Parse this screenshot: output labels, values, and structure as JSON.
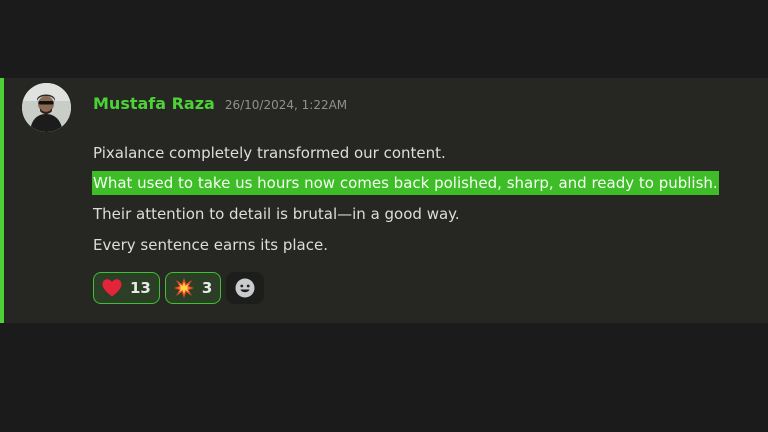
{
  "message": {
    "username": "Mustafa Raza",
    "timestamp": "26/10/2024, 1:22AM",
    "lines": [
      "Pixalance completely transformed our content.",
      "What used to take us hours now comes back polished, sharp, and ready to publish.",
      "Their attention to detail is brutal—in a good way.",
      "Every sentence earns its place."
    ],
    "highlighted_line_index": 1
  },
  "reactions": [
    {
      "emoji": "heart-icon",
      "count": "13"
    },
    {
      "emoji": "collision-icon",
      "count": "3"
    }
  ],
  "add_reaction": {
    "icon": "smiley-add-reaction-icon"
  },
  "colors": {
    "accent": "#4cd137",
    "highlight": "#3ebd29",
    "background": "#1b1b1b",
    "card": "#262622",
    "text": "#dcddde"
  }
}
